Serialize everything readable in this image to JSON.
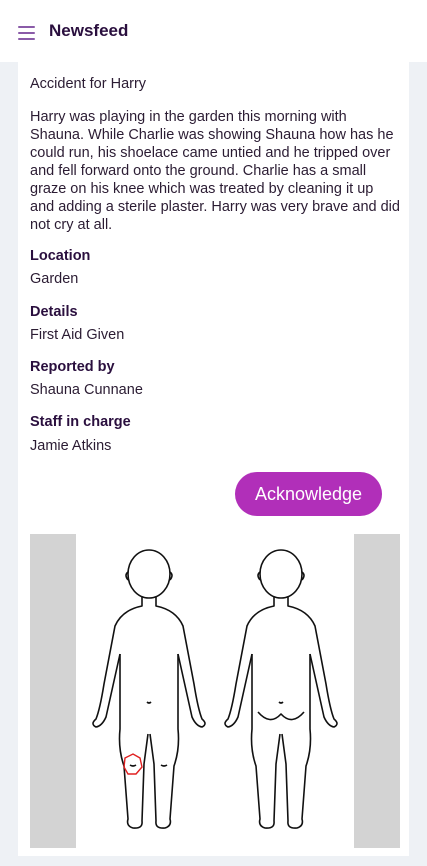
{
  "header": {
    "title": "Newsfeed",
    "menu_icon": "hamburger-menu-icon"
  },
  "incident": {
    "heading": "Accident for Harry",
    "description": "Harry was playing in the garden this morning with Shauna. While Charlie was showing Shauna how has he could run, his shoelace came untied and he tripped over and fell forward onto the ground. Charlie has a small graze on his knee which was treated by cleaning it up and adding a sterile plaster. Harry was very brave and did not cry at all.",
    "location_label": "Location",
    "location": "Garden",
    "details_label": "Details",
    "details": "First Aid Given",
    "reported_by_label": "Reported by",
    "reported_by": "Shauna Cunnane",
    "staff_label": "Staff in charge",
    "staff": "Jamie Atkins"
  },
  "actions": {
    "acknowledge_label": "Acknowledge"
  },
  "colors": {
    "accent": "#b12fb9",
    "title": "#2a0f3e",
    "marker": "#e02020"
  }
}
